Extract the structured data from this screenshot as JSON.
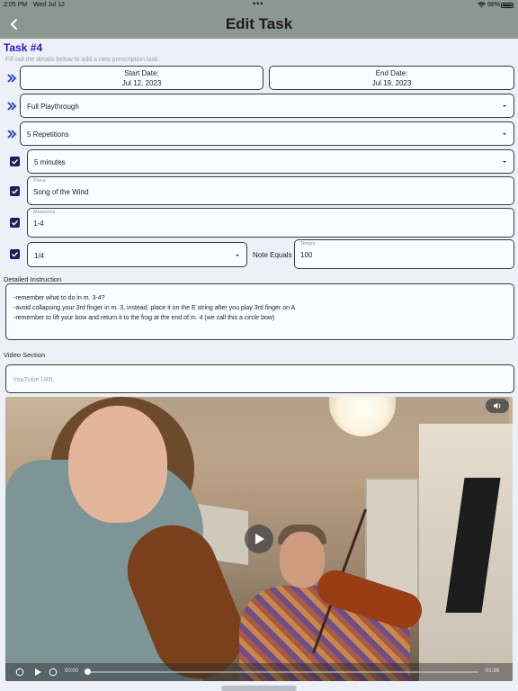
{
  "status_bar": {
    "time": "2:05 PM",
    "date": "Wed Jul 12",
    "battery": "98%"
  },
  "nav": {
    "title": "Edit Task"
  },
  "task": {
    "title": "Task #4",
    "subtitle": "Fill out the details below to add a new prescription task"
  },
  "dates": {
    "start_label": "Start Date:",
    "start_value": "Jul 12, 2023",
    "end_label": "End Date:",
    "end_value": "Jul 19, 2023"
  },
  "selects": {
    "playthrough": "Full Playthrough",
    "repetitions": "5 Repetitions",
    "duration": "5 minutes",
    "note_value": "1/4"
  },
  "fields": {
    "piece_label": "Piece",
    "piece_value": "Song of the Wind",
    "measures_label": "Measures",
    "measures_value": "1-4",
    "note_equals": "Note Equals",
    "tempo_label": "Tempo",
    "tempo_value": "100"
  },
  "instruction": {
    "label": "Detailed Instruction",
    "lines": [
      "-remember what to do in m. 3-4?",
      "-avoid collapsing your 3rd finger in m. 3, instead, place it on the E string after you play 3rd finger on A",
      "-remember to lift your bow and return it to the frog at the end of m. 4 (we call this a circle bow)"
    ]
  },
  "video": {
    "label": "Video Section",
    "url_placeholder": "YouTube URL",
    "time_elapsed": "00:00",
    "time_remaining": "-01:36",
    "progress": 0
  },
  "colors": {
    "header_bg": "#8c9693",
    "accent": "#2f16c8",
    "checkbox": "#1c1f5a",
    "page_bg": "#eef0f7"
  },
  "icons": [
    "back-chevron-icon",
    "double-chevron-icon",
    "checkbox-checked-icon",
    "dropdown-caret-icon",
    "play-icon",
    "speaker-icon",
    "skip-back-icon",
    "skip-forward-icon",
    "wifi-icon",
    "battery-icon"
  ]
}
